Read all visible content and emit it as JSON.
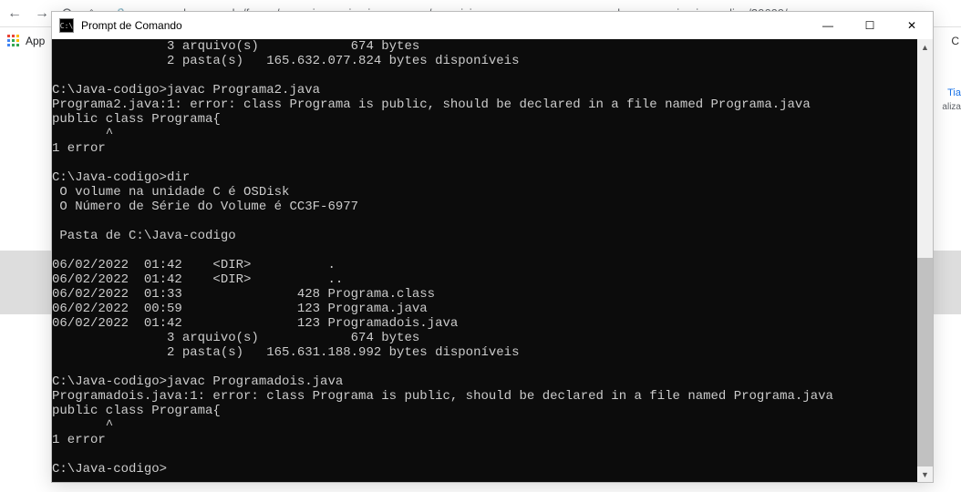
{
  "browser": {
    "url": "cursos.alura.com.br/forum/curso-java-primeiros-passos/exercicio-mao-na-massa-escrevendo-nosso-primeiro-codigo/30609/novo",
    "bookmark_apps": "App",
    "right_c": "C",
    "right_link": "Tia",
    "right_sub": "aliza"
  },
  "cmd": {
    "title": "Prompt de Comando",
    "icon_text": "C:\\",
    "minimize": "—",
    "maximize": "☐",
    "close": "✕",
    "scroll_up": "▲",
    "scroll_down": "▼",
    "lines": [
      "               3 arquivo(s)            674 bytes",
      "               2 pasta(s)   165.632.077.824 bytes disponíveis",
      "",
      "C:\\Java-codigo>javac Programa2.java",
      "Programa2.java:1: error: class Programa is public, should be declared in a file named Programa.java",
      "public class Programa{",
      "       ^",
      "1 error",
      "",
      "C:\\Java-codigo>dir",
      " O volume na unidade C é OSDisk",
      " O Número de Série do Volume é CC3F-6977",
      "",
      " Pasta de C:\\Java-codigo",
      "",
      "06/02/2022  01:42    <DIR>          .",
      "06/02/2022  01:42    <DIR>          ..",
      "06/02/2022  01:33               428 Programa.class",
      "06/02/2022  00:59               123 Programa.java",
      "06/02/2022  01:42               123 Programadois.java",
      "               3 arquivo(s)            674 bytes",
      "               2 pasta(s)   165.631.188.992 bytes disponíveis",
      "",
      "C:\\Java-codigo>javac Programadois.java",
      "Programadois.java:1: error: class Programa is public, should be declared in a file named Programa.java",
      "public class Programa{",
      "       ^",
      "1 error",
      "",
      "C:\\Java-codigo>"
    ]
  }
}
